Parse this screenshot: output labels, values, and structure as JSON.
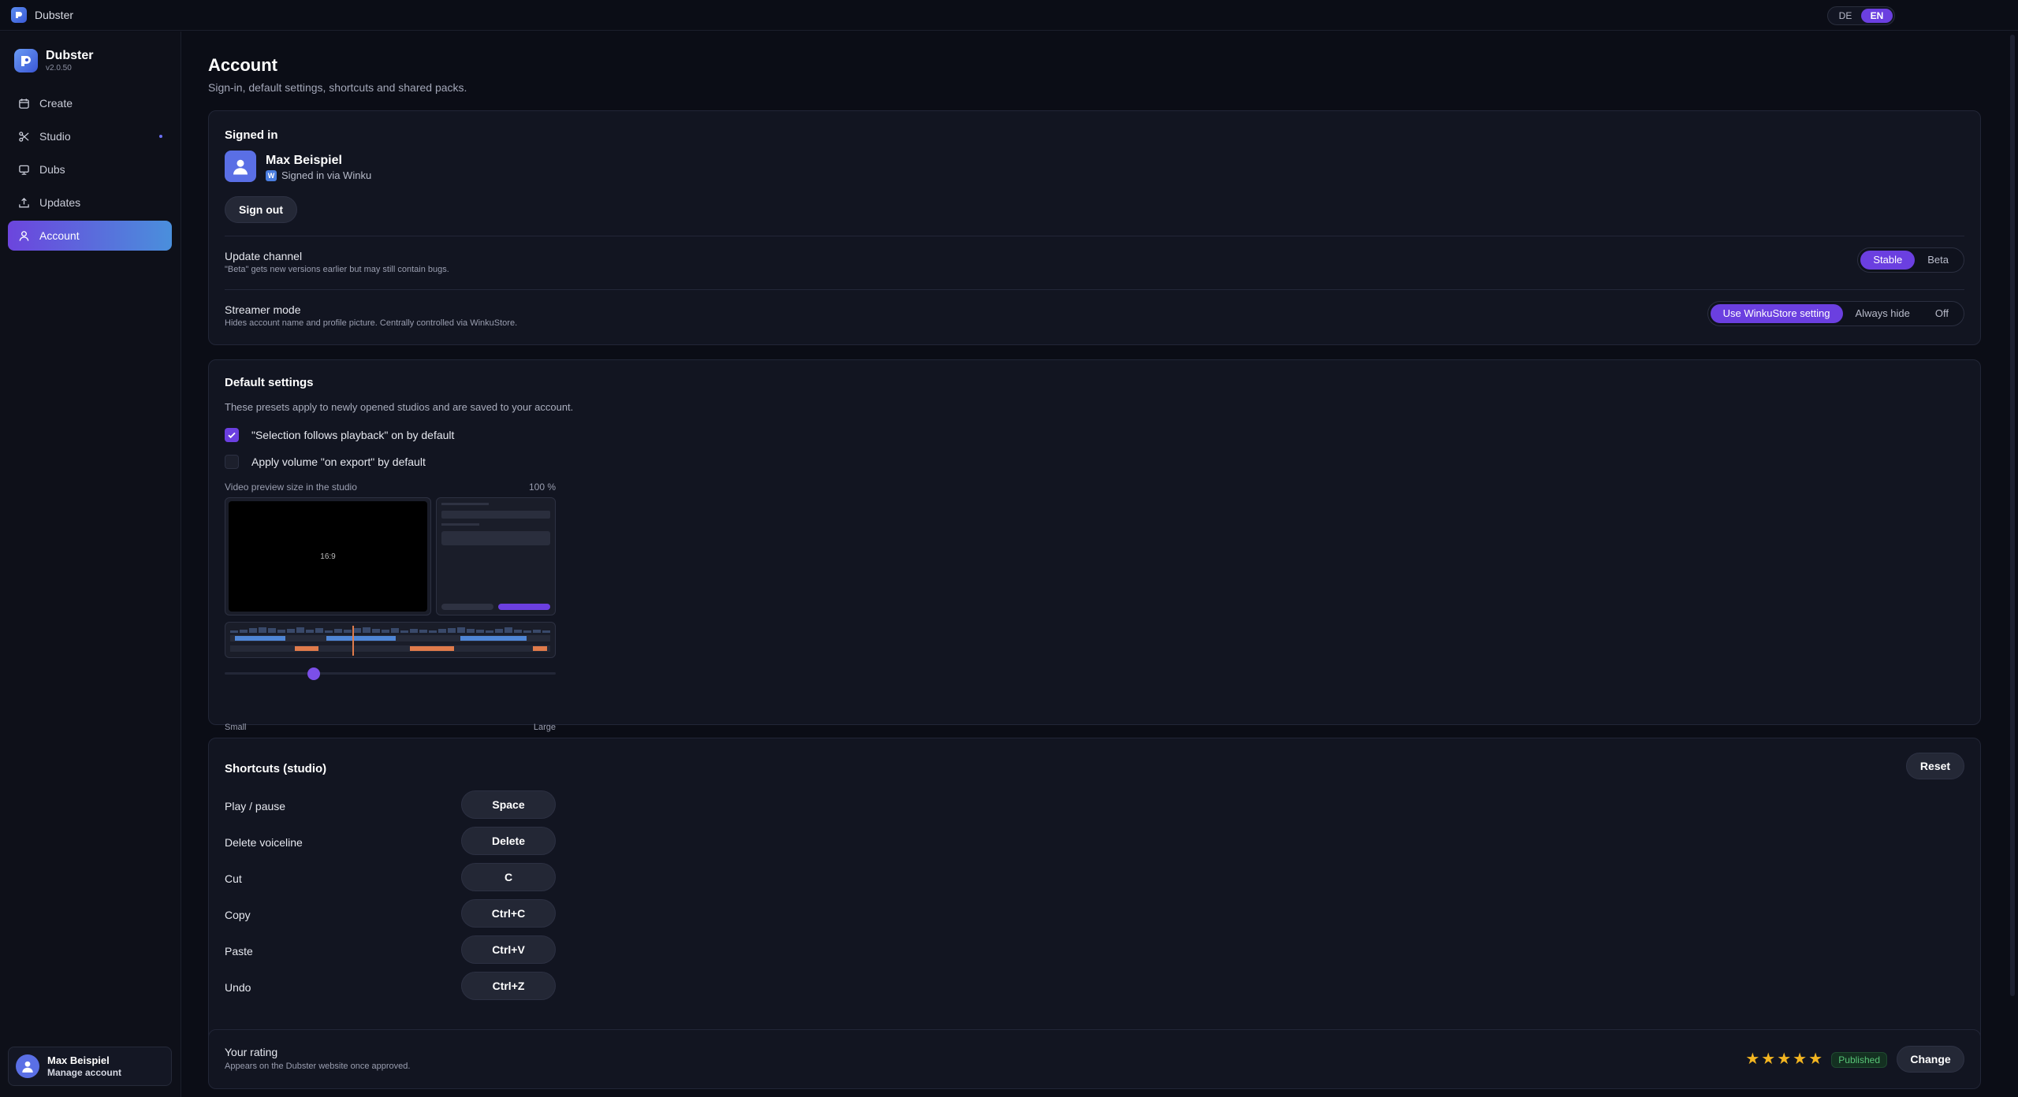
{
  "window": {
    "title": "Dubster",
    "languages": [
      {
        "label": "DE"
      },
      {
        "label": "EN"
      }
    ]
  },
  "sidebar": {
    "brand": {
      "name": "Dubster",
      "version": "v2.0.50"
    },
    "items": [
      {
        "label": "Create",
        "icon": "calendar-icon"
      },
      {
        "label": "Studio",
        "icon": "scissors-icon"
      },
      {
        "label": "Dubs",
        "icon": "monitor-icon"
      },
      {
        "label": "Updates",
        "icon": "upload-icon"
      },
      {
        "label": "Account",
        "icon": "user-icon"
      }
    ],
    "user": {
      "name": "Max Beispiel",
      "action": "Manage account"
    }
  },
  "page": {
    "title": "Account",
    "subtitle": "Sign-in, default settings, shortcuts and shared packs."
  },
  "signed_in": {
    "title": "Signed in",
    "name": "Max Beispiel",
    "provider_badge": "W",
    "provider": "Signed in via Winku",
    "sign_out": "Sign out",
    "update_channel": {
      "label": "Update channel",
      "desc": "\"Beta\" gets new versions earlier but may still contain bugs.",
      "options": [
        "Stable",
        "Beta"
      ],
      "selected": "Stable"
    },
    "streamer_mode": {
      "label": "Streamer mode",
      "desc": "Hides account name and profile picture. Centrally controlled via WinkuStore.",
      "options": [
        "Use WinkuStore setting",
        "Always hide",
        "Off"
      ],
      "selected": "Use WinkuStore setting"
    }
  },
  "defaults": {
    "title": "Default settings",
    "desc": "These presets apply to newly opened studios and are saved to your account.",
    "checks": [
      {
        "label": "\"Selection follows playback\" on by default",
        "checked": true
      },
      {
        "label": "Apply volume \"on export\" by default",
        "checked": false
      }
    ],
    "preview": {
      "label": "Video preview size in the studio",
      "value_text": "100 %",
      "ratio_text": "16:9",
      "slider_fraction": 0.26,
      "min_label": "Small",
      "max_label": "Large"
    }
  },
  "shortcuts": {
    "title": "Shortcuts (studio)",
    "reset": "Reset",
    "items": [
      {
        "label": "Play / pause",
        "key": "Space"
      },
      {
        "label": "Delete voiceline",
        "key": "Delete"
      },
      {
        "label": "Cut",
        "key": "C"
      },
      {
        "label": "Copy",
        "key": "Ctrl+C"
      },
      {
        "label": "Paste",
        "key": "Ctrl+V"
      },
      {
        "label": "Undo",
        "key": "Ctrl+Z"
      }
    ]
  },
  "rating": {
    "label": "Your rating",
    "desc": "Appears on the Dubster website once approved.",
    "stars": 5,
    "status": "Published",
    "change": "Change"
  },
  "colors": {
    "accent": "#6b3fe0",
    "accent_blue": "#4a8fdc",
    "star": "#f3b521",
    "success": "#58c577"
  }
}
